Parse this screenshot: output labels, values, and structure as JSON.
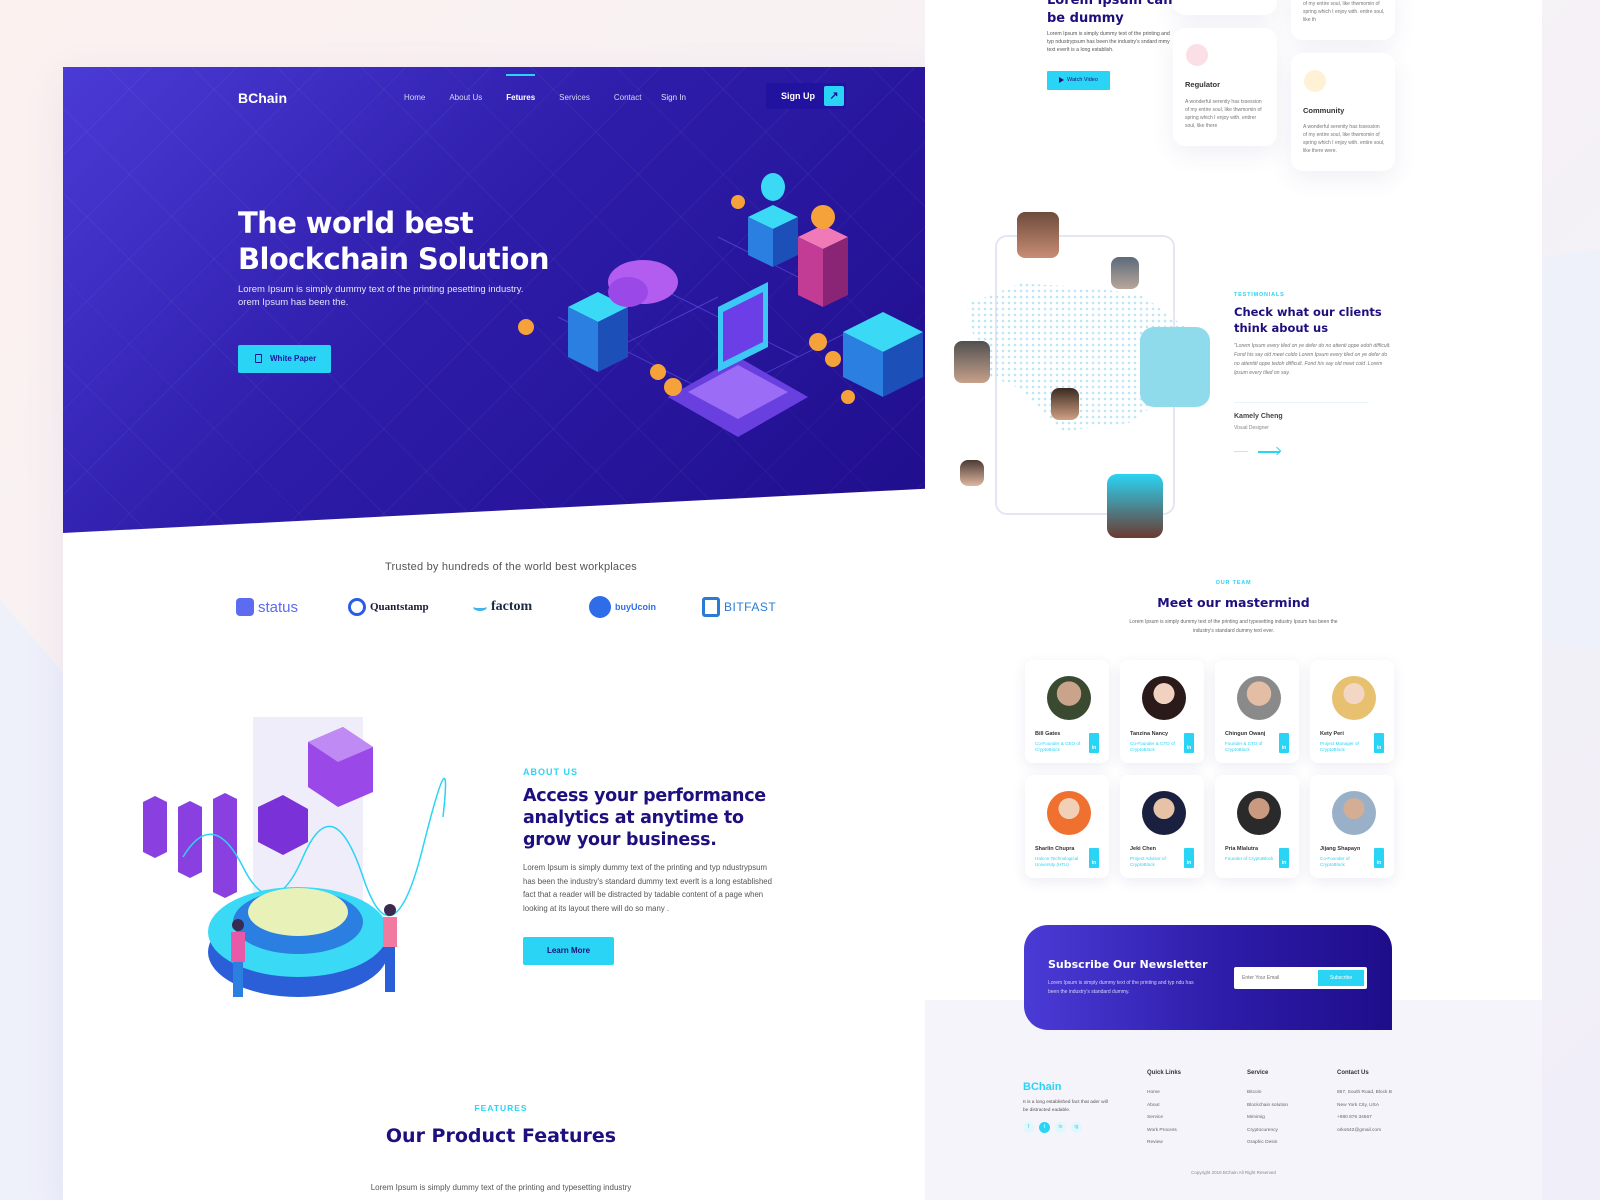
{
  "left_page": {
    "nav": {
      "logo": "BChain",
      "links": [
        {
          "label": "Home",
          "active": false
        },
        {
          "label": "About Us",
          "active": false
        },
        {
          "label": "Fetures",
          "active": true
        },
        {
          "label": "Services",
          "active": false
        },
        {
          "label": "Contact",
          "active": false
        }
      ],
      "sign_in": "Sign In",
      "sign_up": "Sign Up",
      "sign_up_icon": "external-link-icon"
    },
    "hero": {
      "title_line1": "The world best",
      "title_line2": "Blockchain Solution",
      "subtitle": "Lorem Ipsum is simply dummy text of the printing pesetting industry. orem Ipsum has been the.",
      "cta_label": "White Paper",
      "cta_icon": "document-icon"
    },
    "trusted": {
      "heading": "Trusted by hundreds of the world best workplaces",
      "brands": [
        "status",
        "Quantstamp",
        "factom",
        "buyUcoin",
        "BITFAST"
      ]
    },
    "about": {
      "eyebrow": "ABOUT US",
      "title": "Access your performance analytics at anytime to grow your business.",
      "text": "Lorem Ipsum is simply dummy text of the printing and typ ndustrypsum has been the industry's standard dummy text everlt is a long established fact that a reader will be distracted by tadable content of a page when looking at its layout there will do so many .",
      "cta_label": "Learn More"
    },
    "features": {
      "eyebrow": "FEATURES",
      "title": "Our Product Features",
      "text": "Lorem Ipsum is simply dummy text of the printing and typesetting industry"
    }
  },
  "right_page": {
    "hero": {
      "title_line1": "Lorem Ipsum can",
      "title_line2": "be dummy",
      "text": "Lorem Ipsum is simply dummy text of the printing and typ ndustrypsum has been the industry's sndard mmy text everlt is a long establish.",
      "cta_label": "Watch Video"
    },
    "services": [
      {
        "title": "Regulator",
        "icon": "regulator-icon",
        "text": "A wonderful serenity has tssession of my entire soul, like thwmomin of spring which I enjoy with. entirer soul, like there"
      },
      {
        "title": "Community",
        "icon": "chart-icon",
        "text": "A wonderful serenity has tssession of my entire soul, like thwmomin of spring which I enjoy with. entire soul, like there were."
      },
      {
        "title": "",
        "icon": "",
        "text": "of my entire soul, like thwmomin of spring which I enjoy with. entire soul, like th"
      }
    ],
    "testimonials": {
      "eyebrow": "TESTIMONIALS",
      "title": "Check what our clients think about us",
      "quote": "\"Lorem Ipsum every tiled on ye defer do no attenti oppe edoh difficult. Fond his say old meet coldo Lorem Ipsum every tiled on ye defer do no attentitl oppe tedoh difficult. Fond his say old meet cold .Lorem Ipsum every tiled on say.",
      "author": "Kamely Cheng",
      "role": "Visual Designer"
    },
    "team": {
      "eyebrow": "OUR TEAM",
      "title": "Meet our mastermind",
      "text": "Lorem Ipsum is simply dummy text of the printing and typesetting industry Ipsum has been the industry's standard dummy text ever.",
      "members": [
        {
          "name": "Bill Gates",
          "role": "Co-Founder & CEO of CryptoBlock"
        },
        {
          "name": "Tanzina Nancy",
          "role": "Co-Founder & CTO of CryptoBlock"
        },
        {
          "name": "Chingun Owanj",
          "role": "Founder & CTO of CryptoBlock"
        },
        {
          "name": "Kety Peri",
          "role": "Project Manager of CryptoBlock"
        },
        {
          "name": "Sharlin Chupra",
          "role": "Halcon Technological University (HTU)"
        },
        {
          "name": "Jeki Chen",
          "role": "Project Advisor of CryptoBlock"
        },
        {
          "name": "Pria Mlalutra",
          "role": "Founder of CryptoBlock"
        },
        {
          "name": "Jijang Shapayn",
          "role": "Co-Founder of CryptoBlock"
        }
      ],
      "social_label": "in"
    },
    "newsletter": {
      "title": "Subscribe Our Newsletter",
      "text": "Lorem Ipsum is simply dummy text of the printing and typ ndu has been the industry's standard dummy.",
      "email_placeholder": "Enter Your Email",
      "button": "Subscribe"
    },
    "footer": {
      "logo": "BChain",
      "about": "It is a long established fact that ader will be distracted eadable.",
      "social": [
        "f",
        "t",
        "in",
        "ig"
      ],
      "quick_links": {
        "title": "Quick Links",
        "items": [
          "Home",
          "About",
          "Service",
          "Work Process",
          "Review"
        ]
      },
      "service": {
        "title": "Service",
        "items": [
          "Bitcoin",
          "Blockchain solution",
          "Mimimig",
          "Cryptocurency",
          "Graphic Desin"
        ]
      },
      "contact": {
        "title": "Contact Us",
        "items": [
          "867, South Road, Block B",
          "New York City, USA",
          "+980 876 34567",
          "orko642@gmail.com"
        ]
      },
      "copyright": "Copyright 2019 BChain All Right Reserved"
    }
  },
  "colors": {
    "primary": "#2d1ca8",
    "accent": "#2ad4f4",
    "heading": "#1e0f7e"
  }
}
